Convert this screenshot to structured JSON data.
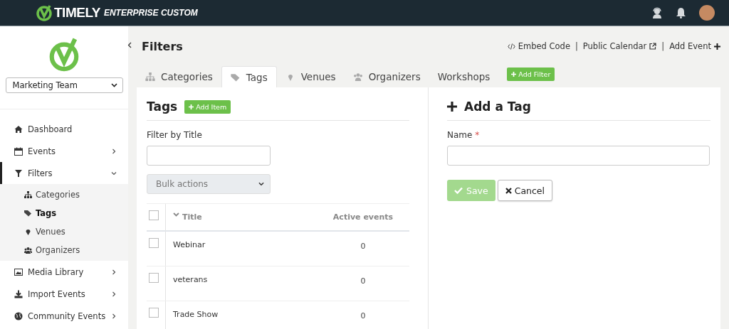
{
  "header": {
    "brand": "TIMELY",
    "edition": "ENTERPRISE CUSTOM"
  },
  "sidebar": {
    "calendar_select": "Marketing Team",
    "items": [
      {
        "label": "Dashboard",
        "expandable": false,
        "selected": false
      },
      {
        "label": "Events",
        "expandable": true,
        "expanded": false,
        "selected": false
      },
      {
        "label": "Filters",
        "expandable": true,
        "expanded": true,
        "selected": true,
        "children": [
          {
            "label": "Categories",
            "selected": false
          },
          {
            "label": "Tags",
            "selected": true
          },
          {
            "label": "Venues",
            "selected": false
          },
          {
            "label": "Organizers",
            "selected": false
          }
        ]
      },
      {
        "label": "Media Library",
        "expandable": true,
        "expanded": false,
        "selected": false
      },
      {
        "label": "Import Events",
        "expandable": true,
        "expanded": false,
        "selected": false
      },
      {
        "label": "Community Events",
        "expandable": true,
        "expanded": false,
        "selected": false
      }
    ]
  },
  "page": {
    "title": "Filters",
    "links": [
      "Embed Code",
      "Public Calendar",
      "Add Event"
    ],
    "separators": [
      "|",
      "|"
    ]
  },
  "tabs": [
    {
      "label": "Categories",
      "selected": false
    },
    {
      "label": "Tags",
      "selected": true
    },
    {
      "label": "Venues",
      "selected": false
    },
    {
      "label": "Organizers",
      "selected": false
    },
    {
      "label": "Workshops",
      "selected": false
    }
  ],
  "add_filter_button": "Add Filter",
  "list_panel": {
    "title": "Tags",
    "add_button": "Add Item",
    "filter_label": "Filter by Title",
    "bulk_select": "Bulk actions",
    "table": {
      "columns": [
        "Title",
        "Active events"
      ],
      "all_checked": false,
      "rows": [
        {
          "title": "Webinar",
          "active_events": "0",
          "checked": false
        },
        {
          "title": "veterans",
          "active_events": "0",
          "checked": false
        },
        {
          "title": "Trade Show",
          "active_events": "0",
          "checked": false
        }
      ]
    }
  },
  "form_panel": {
    "title": "Add a Tag",
    "name_label": "Name",
    "required_mark": "*",
    "save_button": {
      "label": "Save",
      "disabled": true
    },
    "cancel_button": "Cancel"
  }
}
